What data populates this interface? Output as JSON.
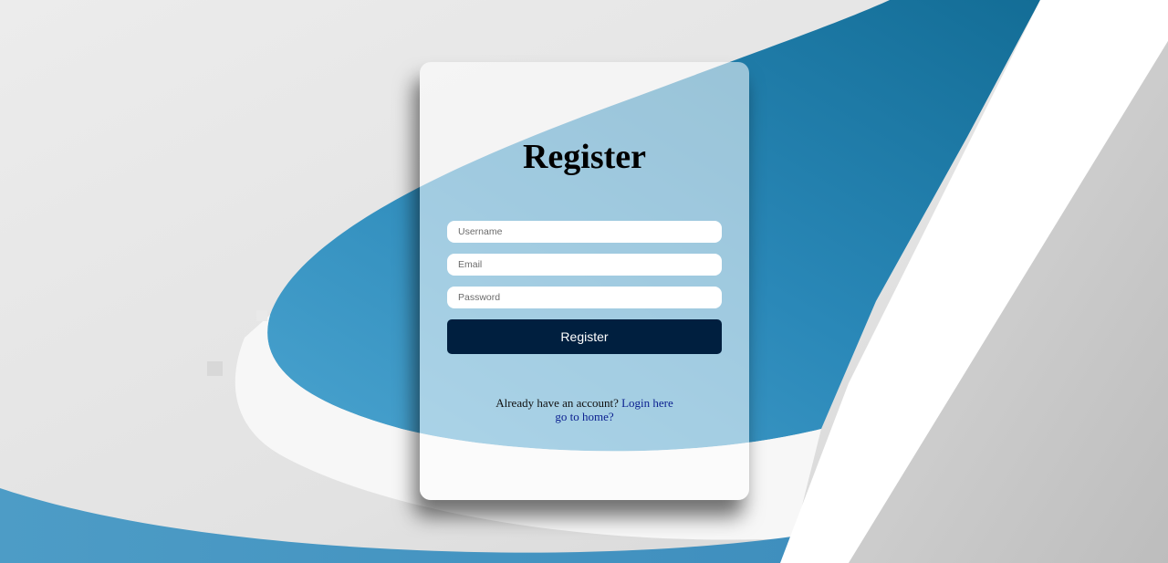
{
  "register_form": {
    "title": "Register",
    "username_placeholder": "Username",
    "email_placeholder": "Email",
    "password_placeholder": "Password",
    "submit_label": "Register"
  },
  "footer": {
    "account_prompt": "Already have an account?",
    "login_link": "Login here",
    "home_link": "go to home?"
  },
  "colors": {
    "accent_blue": "#1f7fae",
    "button_navy": "#001f3f",
    "link_blue": "#0a1f8f",
    "background_gray": "#e6e6e6"
  }
}
